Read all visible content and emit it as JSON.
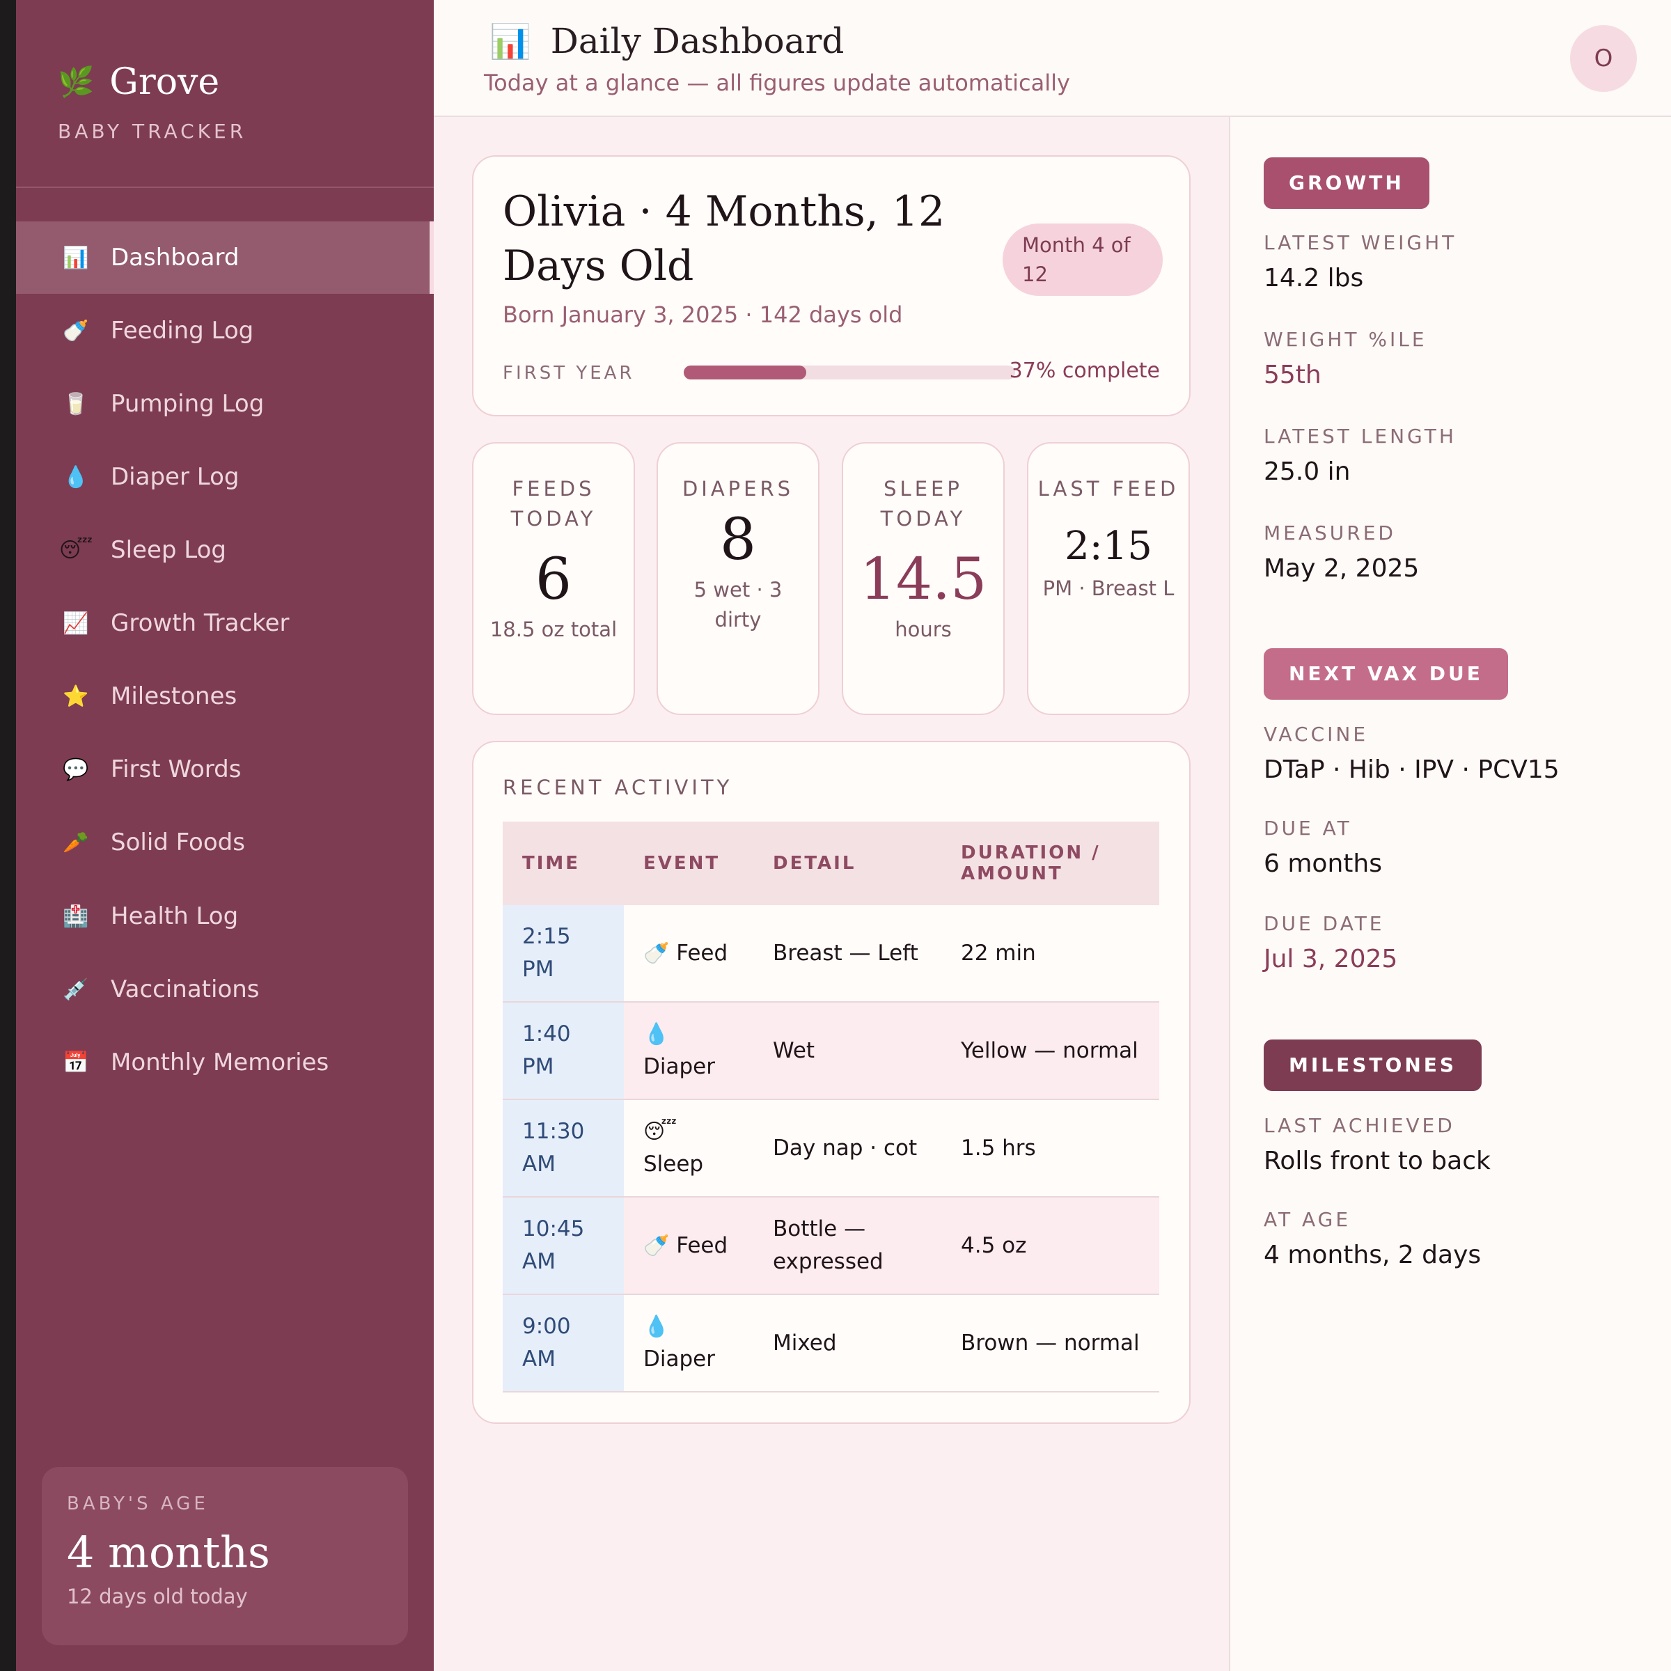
{
  "brand": {
    "name": "Grove",
    "subtitle": "BABY TRACKER",
    "icon": "leaf-icon"
  },
  "sidebar": {
    "items": [
      {
        "label": "Dashboard",
        "icon": "chart-icon",
        "glyph": "📊",
        "active": true
      },
      {
        "label": "Feeding Log",
        "icon": "bottle-icon",
        "glyph": "🍼"
      },
      {
        "label": "Pumping Log",
        "icon": "cup-icon",
        "glyph": "🥛"
      },
      {
        "label": "Diaper Log",
        "icon": "droplet-icon",
        "glyph": "💧"
      },
      {
        "label": "Sleep Log",
        "icon": "sleeping-face-icon",
        "glyph": "😴"
      },
      {
        "label": "Growth Tracker",
        "icon": "trend-chart-icon",
        "glyph": "📈"
      },
      {
        "label": "Milestones",
        "icon": "star-icon",
        "glyph": "⭐"
      },
      {
        "label": "First Words",
        "icon": "speech-bubble-icon",
        "glyph": "💬"
      },
      {
        "label": "Solid Foods",
        "icon": "carrot-icon",
        "glyph": "🥕"
      },
      {
        "label": "Health Log",
        "icon": "hospital-icon",
        "glyph": "🏥"
      },
      {
        "label": "Vaccinations",
        "icon": "syringe-icon",
        "glyph": "💉"
      },
      {
        "label": "Monthly Memories",
        "icon": "calendar-icon",
        "glyph": "📅"
      }
    ],
    "age_card": {
      "label": "BABY'S AGE",
      "value": "4 months",
      "sub": "12 days old today"
    }
  },
  "header": {
    "icon": "chart-icon",
    "title": "Daily Dashboard",
    "subtitle": "Today at a glance — all figures update automatically",
    "avatar_initial": "O"
  },
  "profile": {
    "name": "Olivia · 4 Months, 12 Days Old",
    "month_pill": "Month 4 of 12",
    "born": "Born January 3, 2025 · 142 days old",
    "progress_label": "FIRST YEAR",
    "progress_fraction": 0.37,
    "progress_text": "37% complete"
  },
  "stats": [
    {
      "label": "FEEDS TODAY",
      "value": "6",
      "sub": "18.5 oz total"
    },
    {
      "label": "DIAPERS",
      "value": "8",
      "sub": "5 wet · 3 dirty"
    },
    {
      "label": "SLEEP TODAY",
      "value": "14.5",
      "sub": "hours"
    },
    {
      "label": "LAST FEED",
      "value": "2:15",
      "sub": "PM · Breast L"
    }
  ],
  "activity": {
    "title": "RECENT ACTIVITY",
    "columns": [
      "TIME",
      "EVENT",
      "DETAIL",
      "DURATION / AMOUNT"
    ],
    "rows": [
      {
        "time": "2:15 PM",
        "icon": "bottle-icon",
        "glyph": "🍼",
        "event": "Feed",
        "detail": "Breast — Left",
        "amount": "22 min"
      },
      {
        "time": "1:40 PM",
        "icon": "droplet-icon",
        "glyph": "💧",
        "event": "Diaper",
        "detail": "Wet",
        "amount": "Yellow — normal"
      },
      {
        "time": "11:30 AM",
        "icon": "sleeping-face-icon",
        "glyph": "😴",
        "event": "Sleep",
        "detail": "Day nap · cot",
        "amount": "1.5 hrs"
      },
      {
        "time": "10:45 AM",
        "icon": "bottle-icon",
        "glyph": "🍼",
        "event": "Feed",
        "detail": "Bottle — expressed",
        "amount": "4.5 oz"
      },
      {
        "time": "9:00 AM",
        "icon": "droplet-icon",
        "glyph": "💧",
        "event": "Diaper",
        "detail": "Mixed",
        "amount": "Brown — normal"
      }
    ]
  },
  "growth": {
    "badge": "GROWTH",
    "badge_color": "#a8506d",
    "items": [
      {
        "label": "LATEST WEIGHT",
        "value": "14.2 lbs"
      },
      {
        "label": "WEIGHT %ILE",
        "value": "55th"
      },
      {
        "label": "LATEST LENGTH",
        "value": "25.0 in"
      },
      {
        "label": "MEASURED",
        "value": "May 2, 2025"
      }
    ]
  },
  "vax": {
    "badge": "NEXT VAX DUE",
    "badge_color": "#c46d8a",
    "items": [
      {
        "label": "VACCINE",
        "value": "DTaP · Hib · IPV · PCV15"
      },
      {
        "label": "DUE AT",
        "value": "6 months"
      },
      {
        "label": "DUE DATE",
        "value": "Jul 3, 2025"
      }
    ]
  },
  "milestones": {
    "badge": "MILESTONES",
    "badge_color": "#7d3c52",
    "items": [
      {
        "label": "LAST ACHIEVED",
        "value": "Rolls front to back"
      },
      {
        "label": "AT AGE",
        "value": "4 months, 2 days"
      }
    ]
  }
}
